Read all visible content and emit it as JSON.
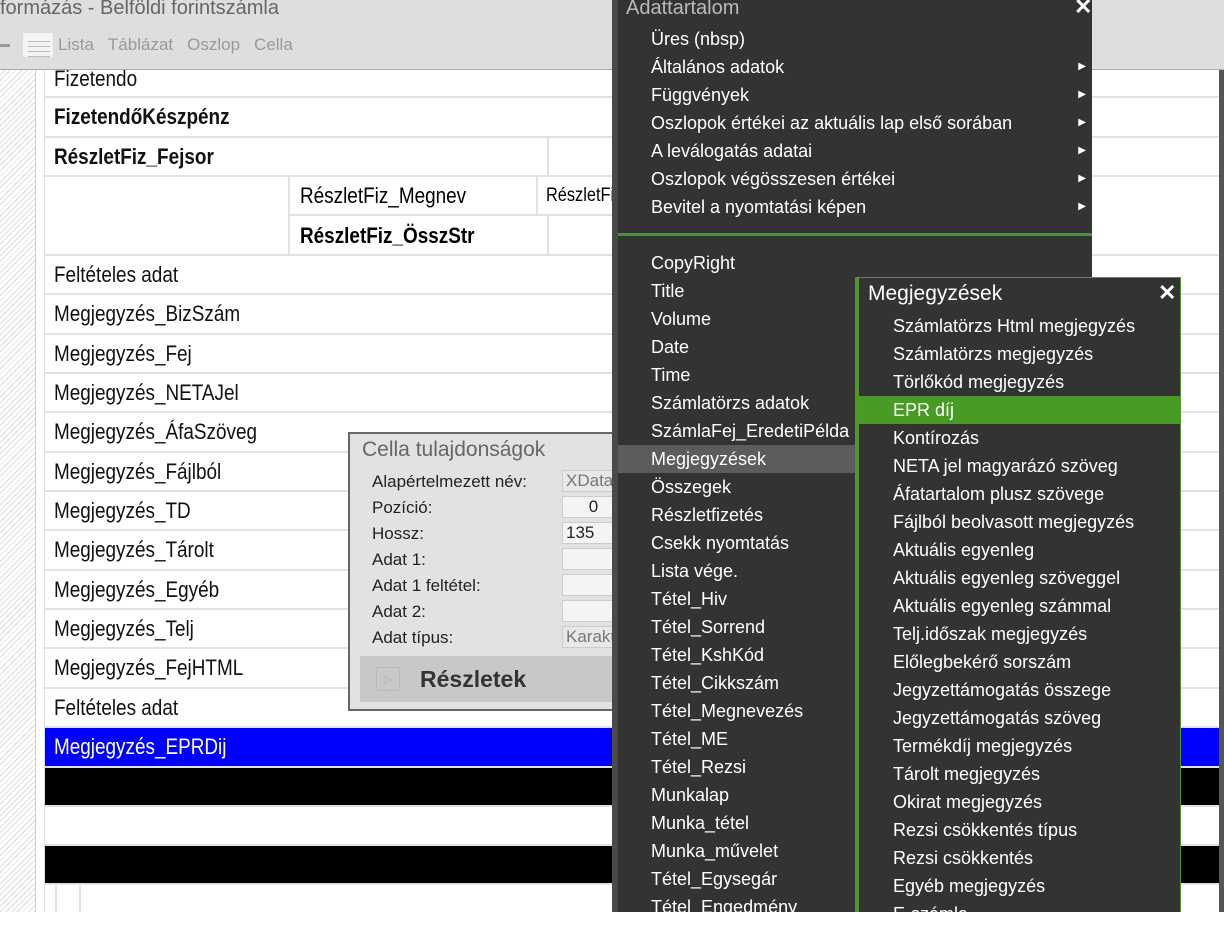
{
  "window": {
    "title": "formázás - Belföldi forintszámla"
  },
  "toolbar": {
    "items": [
      "Lista",
      "Táblázat",
      "Oszlop",
      "Cella"
    ]
  },
  "rows": {
    "fizetendo": "Fizetendo",
    "fizetendo_keszpenz": "FizetendőKészpénz",
    "reszletfiz_fejsor": "RészletFiz_Fejsor",
    "reszletfiz_megnev": "RészletFiz_Megnev",
    "reszletfiz_cut": "RészletFiz_",
    "reszletfiz_osszstr": "RészletFiz_ÖsszStr",
    "list": [
      "Feltételes adat",
      "Megjegyzés_BizSzám",
      "Megjegyzés_Fej",
      "Megjegyzés_NETAJel",
      "Megjegyzés_ÁfaSzöveg",
      "Megjegyzés_Fájlból",
      "Megjegyzés_TD",
      "Megjegyzés_Tárolt",
      "Megjegyzés_Egyéb",
      "Megjegyzés_Telj",
      "Megjegyzés_FejHTML",
      "Feltételes adat"
    ],
    "selected": "Megjegyzés_EPRDij"
  },
  "dialog": {
    "title": "Cella tulajdonságok",
    "labels": [
      "Alapértelmezett név:",
      "Pozíció:",
      "Hossz:",
      "Adat 1:",
      "Adat 1 feltétel:",
      "Adat 2:",
      "Adat típus:"
    ],
    "values": [
      "XData",
      "0",
      "135",
      "",
      "",
      "",
      "Karakt"
    ],
    "details": "Részletek"
  },
  "menu": {
    "title": "Adattartalom",
    "close": "✕",
    "top_items": [
      "Üres (nbsp)",
      "Általános adatok",
      "Függvények",
      "Oszlopok értékei az aktuális lap első sorában",
      "A leválogatás adatai",
      "Oszlopok végösszesen értékei",
      "Bevitel a nyomtatási képen"
    ],
    "items": [
      "CopyRight",
      "Title",
      "Volume",
      "Date",
      "Time",
      "Számlatörzs adatok",
      "SzámlaFej_EredetiPélda",
      "Megjegyzések",
      "Összegek",
      "Részletfizetés",
      "Csekk nyomtatás",
      "Lista vége.",
      "Tétel_Hiv",
      "Tétel_Sorrend",
      "Tétel_KshKód",
      "Tétel_Cikkszám",
      "Tétel_Megnevezés",
      "Tétel_ME",
      "Tétel_Rezsi",
      "Munkalap",
      "Munka_tétel",
      "Munka_művelet",
      "Tétel_Egysegár",
      "Tétel_Engedmény"
    ],
    "highlighted": "Megjegyzések"
  },
  "submenu": {
    "title": "Megjegyzések",
    "close": "✕",
    "items": [
      "Számlatörzs Html megjegyzés",
      "Számlatörzs megjegyzés",
      "Törlőkód megjegyzés",
      "EPR díj",
      "Kontírozás",
      "NETA jel magyarázó szöveg",
      "Áfatartalom plusz szövege",
      "Fájlból beolvasott megjegyzés",
      "Aktuális egyenleg",
      "Aktuális egyenleg szöveggel",
      "Aktuális egyenleg számmal",
      "Telj.időszak megjegyzés",
      "Előlegbekérő sorszám",
      "Jegyzettámogatás összege",
      "Jegyzettámogatás szöveg",
      "Termékdíj megjegyzés",
      "Tárolt megjegyzés",
      "Okirat megjegyzés",
      "Rezsi csökkentés típus",
      "Rezsi csökkentés",
      "Egyéb megjegyzés",
      "E-számla"
    ],
    "highlighted": "EPR díj"
  },
  "colors": {
    "selected_row": "#0000ff",
    "menu_bg": "#333333",
    "accent": "#4a9a26"
  }
}
